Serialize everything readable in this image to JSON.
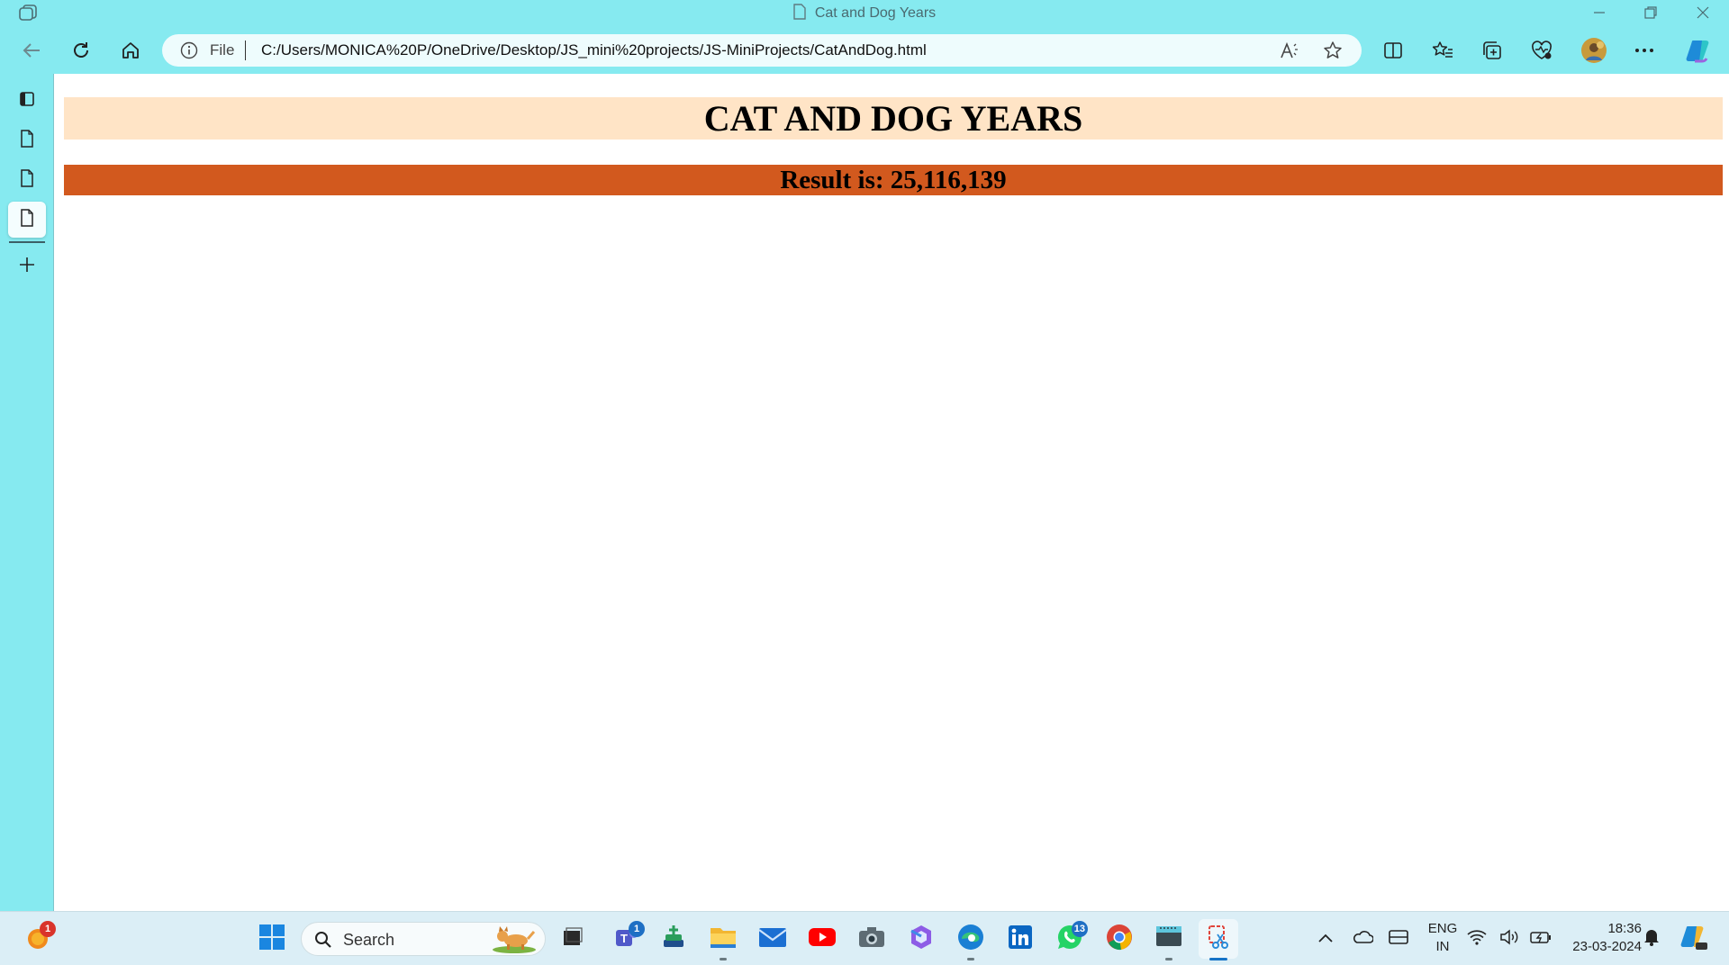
{
  "window": {
    "title": "Cat and Dog Years"
  },
  "addressbar": {
    "scheme_label": "File",
    "url": "C:/Users/MONICA%20P/OneDrive/Desktop/JS_mini%20projects/JS-MiniProjects/CatAndDog.html"
  },
  "page": {
    "heading": "CAT AND DOG YEARS",
    "result_text": "Result is: 25,116,139",
    "heading_bg": "#ffe4c6",
    "result_bg": "#d2591e"
  },
  "taskbar": {
    "search_placeholder": "Search",
    "weather_badge": "1",
    "teams_badge": "1",
    "whatsapp_badge": "13",
    "language_line1": "ENG",
    "language_line2": "IN",
    "time": "18:36",
    "date": "23-03-2024"
  },
  "colors": {
    "chrome_bg": "#86eaf0",
    "taskbar_bg": "#dbeef6",
    "accent": "#1673c7"
  }
}
